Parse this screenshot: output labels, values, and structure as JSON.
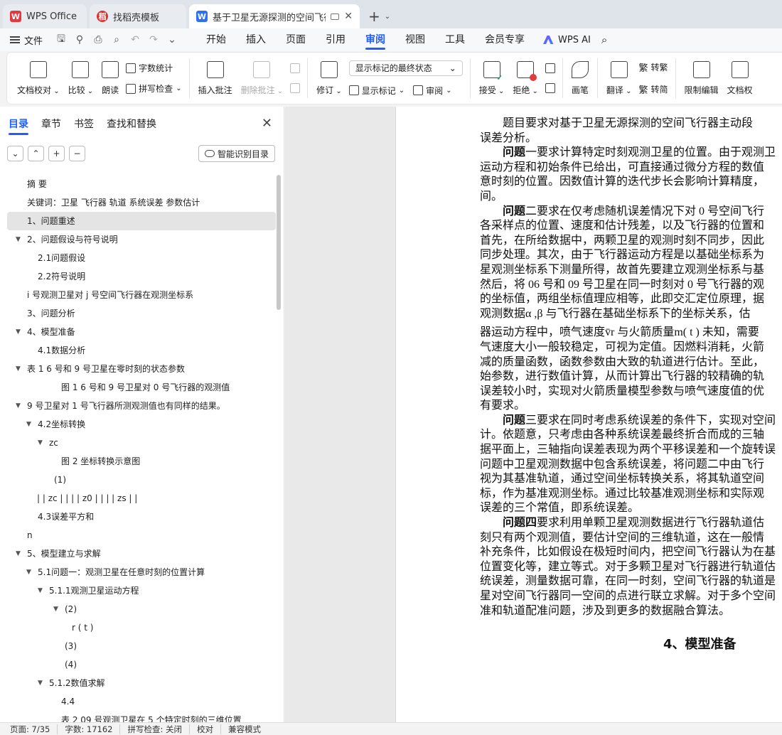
{
  "tabs": [
    {
      "label": "WPS Office",
      "logo": "W"
    },
    {
      "label": "找稻壳模板",
      "logo": "稻"
    },
    {
      "label": "基于卫星无源探测的空间飞行器",
      "logo": "W"
    }
  ],
  "menu": {
    "file": "文件",
    "tabs": [
      "开始",
      "插入",
      "页面",
      "引用",
      "审阅",
      "视图",
      "工具",
      "会员专享"
    ],
    "active_tab": "审阅",
    "ai": "WPS AI"
  },
  "ribbon": {
    "doc_check": "文档校对",
    "compare": "比较",
    "read_aloud": "朗读",
    "word_count": "字数统计",
    "spell_check": "拼写检查",
    "insert_comment": "插入批注",
    "delete_comment": "删除批注",
    "revise": "修订",
    "markup_state": "显示标记的最终状态",
    "show_markup": "显示标记",
    "review": "审阅",
    "accept": "接受",
    "reject": "拒绝",
    "pen": "画笔",
    "translate": "翻译",
    "to_traditional": "繁",
    "to_traditional_label": "转繁",
    "to_simplified": "繁",
    "to_simplified_label": "转简",
    "restrict_edit": "限制编辑",
    "doc_permission": "文档权"
  },
  "nav": {
    "tabs": [
      "目录",
      "章节",
      "书签",
      "查找和替换"
    ],
    "active": "目录",
    "smart_button": "智能识别目录",
    "tools": [
      "⌄",
      "⌃",
      "+",
      "−"
    ],
    "toc": [
      {
        "text": "摘  要",
        "indent": 28,
        "caret": false
      },
      {
        "text": "关键词：卫星 飞行器 轨道 系统误差 参数估计",
        "indent": 28,
        "caret": false
      },
      {
        "text": "1、问题重述",
        "indent": 28,
        "caret": false,
        "selected": true
      },
      {
        "text": "2、问题假设与符号说明",
        "indent": 28,
        "caret": true
      },
      {
        "text": "2.1问题假设",
        "indent": 43,
        "caret": false
      },
      {
        "text": "2.2符号说明",
        "indent": 43,
        "caret": false
      },
      {
        "text": "i 号观测卫星对 j 号空间飞行器在观测坐标系",
        "indent": 28,
        "caret": false
      },
      {
        "text": "3、问题分析",
        "indent": 28,
        "caret": false
      },
      {
        "text": "4、模型准备",
        "indent": 28,
        "caret": true
      },
      {
        "text": "4.1数据分析",
        "indent": 43,
        "caret": false
      },
      {
        "text": "表 1 6 号和 9 号卫星在零时刻的状态参数",
        "indent": 28,
        "caret": true
      },
      {
        "text": "图 1 6 号和 9 号卫星对 0 号飞行器的观测值",
        "indent": 76,
        "caret": false
      },
      {
        "text": "9 号卫星对 1 号飞行器所测观测值也有同样的结果。",
        "indent": 28,
        "caret": true
      },
      {
        "text": "4.2坐标转换",
        "indent": 43,
        "caret": true
      },
      {
        "text": "zc",
        "indent": 59,
        "caret": true
      },
      {
        "text": "图 2 坐标转换示意图",
        "indent": 76,
        "caret": false
      },
      {
        "text": "(1)",
        "indent": 66,
        "caret": false
      },
      {
        "text": "|  |    zc  |  |    |  |    z0  |  |    |  |    zs  |  |",
        "indent": 42,
        "caret": false
      },
      {
        "text": "4.3误差平方和",
        "indent": 43,
        "caret": false
      },
      {
        "text": "n",
        "indent": 28,
        "caret": false
      },
      {
        "text": "5、模型建立与求解",
        "indent": 28,
        "caret": true
      },
      {
        "text": "5.1问题一：观测卫星在任意时刻的位置计算",
        "indent": 43,
        "caret": true
      },
      {
        "text": "5.1.1观测卫星运动方程",
        "indent": 59,
        "caret": true
      },
      {
        "text": "(2)",
        "indent": 81,
        "caret": true
      },
      {
        "text": "r ( t )",
        "indent": 91,
        "caret": false
      },
      {
        "text": "(3)",
        "indent": 81,
        "caret": false
      },
      {
        "text": "(4)",
        "indent": 81,
        "caret": false
      },
      {
        "text": "5.1.2数值求解",
        "indent": 59,
        "caret": true
      },
      {
        "text": "4.4",
        "indent": 76,
        "caret": false
      },
      {
        "text": "表 2 09 号观测卫星在 5 个特定时刻的三维位置",
        "indent": 76,
        "caret": false
      }
    ]
  },
  "document": {
    "lines": [
      {
        "text": "题目要求对基于卫星无源探测的空间飞行器主动段",
        "indent": true
      },
      {
        "text": "误差分析。",
        "indent": false
      },
      {
        "bold": "问题",
        "text": "一要求计算特定时刻观测卫星的位置。由于观测卫",
        "indent": true
      },
      {
        "text": "运动方程和初始条件已给出，可直接通过微分方程的数值",
        "indent": false
      },
      {
        "text": "意时刻的位置。因数值计算的迭代步长会影响计算精度，",
        "indent": false
      },
      {
        "text": "间。",
        "indent": false
      },
      {
        "bold": "问题",
        "text": "二要求在仅考虑随机误差情况下对 0 号空间飞行",
        "indent": true
      },
      {
        "text": "各采样点的位置、速度和估计残差，以及飞行器的位置和",
        "indent": false
      },
      {
        "text": "首先，在所给数据中，两颗卫星的观测时刻不同步，因此",
        "indent": false
      },
      {
        "text": "同步处理。其次，由于飞行器运动方程是以基础坐标系为",
        "indent": false
      },
      {
        "text": "星观测坐标系下测量所得，故首先要建立观测坐标系与基",
        "indent": false
      },
      {
        "text": "然后，将 06 号和 09 号卫星在同一时刻对 0 号飞行器的观",
        "indent": false
      },
      {
        "text": "的坐标值，两组坐标值理应相等，此即交汇定位原理，据",
        "indent": false
      },
      {
        "text": "观测数据α ,β 与飞行器在基础坐标系下的坐标关系，估",
        "indent": false,
        "gap": 6
      },
      {
        "text": "器运动方程中，喷气速度v̄r 与火箭质量m( t ) 未知，需要",
        "indent": false
      },
      {
        "text": "气速度大小一般较稳定，可视为定值。因燃料消耗，火箭",
        "indent": false
      },
      {
        "text": "减的质量函数，函数参数由大致的轨道进行估计。至此，",
        "indent": false
      },
      {
        "text": "始参数，进行数值计算，从而计算出飞行器的较精确的轨",
        "indent": false
      },
      {
        "text": "误差较小时，实现对火箭质量模型参数与喷气速度值的优",
        "indent": false
      },
      {
        "text": "有要求。",
        "indent": false
      },
      {
        "bold": "问题",
        "text": "三要求在同时考虑系统误差的条件下，实现对空间",
        "indent": true
      },
      {
        "text": "计。依题意，只考虑由各种系统误差最终折合而成的三轴",
        "indent": false
      },
      {
        "text": "据平面上，三轴指向误差表现为两个平移误差和一个旋转误",
        "indent": false
      },
      {
        "text": "问题中卫星观测数据中包含系统误差，将问题二中由飞行",
        "indent": false
      },
      {
        "text": "视为其基准轨道，通过空间坐标转换关系，将其轨道空间",
        "indent": false
      },
      {
        "text": "标，作为基准观测坐标。通过比较基准观测坐标和实际观",
        "indent": false
      },
      {
        "text": "误差的三个常值，即系统误差。",
        "indent": false
      },
      {
        "bold": "问题四",
        "text": "要求利用单颗卫星观测数据进行飞行器轨道估",
        "indent": true
      },
      {
        "text": "刻只有两个观测值，要估计空间的三维轨道，这在一般情",
        "indent": false
      },
      {
        "text": "补充条件，比如假设在极短时间内，把空间飞行器认为在基",
        "indent": false
      },
      {
        "text": "位置变化等，建立等式。对于多颗卫星对飞行器进行轨道估",
        "indent": false
      },
      {
        "text": "统误差，测量数据可靠，在同一时刻，空间飞行器的轨道是",
        "indent": false
      },
      {
        "text": "星对空间飞行器同一空间的点进行联立求解。对于多个空间",
        "indent": false
      },
      {
        "text": "准和轨道配准问题，涉及到更多的数据融合算法。",
        "indent": false
      }
    ],
    "heading": "4、模型准备"
  },
  "status": {
    "page": "页面: 7/35",
    "words": "字数: 17162",
    "spell": "拼写检查: 关闭",
    "proof": "校对",
    "compat": "兼容模式"
  }
}
